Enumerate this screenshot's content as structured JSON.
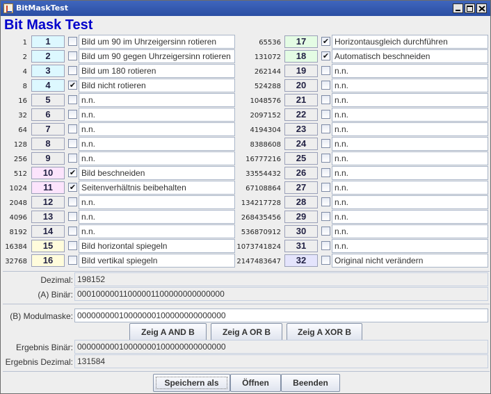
{
  "window": {
    "title": "BitMaskTest"
  },
  "heading": "Bit Mask Test",
  "left_rows": [
    {
      "value": "1",
      "bit": "1",
      "bit_color": "#ddf8ff",
      "checked": false,
      "label": "Bild um 90 im Uhrzeigersinn rotieren"
    },
    {
      "value": "2",
      "bit": "2",
      "bit_color": "#ddf8ff",
      "checked": false,
      "label": "Bild um 90 gegen Uhrzeigersinn rotieren"
    },
    {
      "value": "4",
      "bit": "3",
      "bit_color": "#ddf8ff",
      "checked": false,
      "label": "Bild um 180 rotieren"
    },
    {
      "value": "8",
      "bit": "4",
      "bit_color": "#ddf8ff",
      "checked": true,
      "label": "Bild nicht rotieren"
    },
    {
      "value": "16",
      "bit": "5",
      "bit_color": "#eeeeee",
      "checked": false,
      "label": "n.n."
    },
    {
      "value": "32",
      "bit": "6",
      "bit_color": "#eeeeee",
      "checked": false,
      "label": "n.n."
    },
    {
      "value": "64",
      "bit": "7",
      "bit_color": "#eeeeee",
      "checked": false,
      "label": "n.n."
    },
    {
      "value": "128",
      "bit": "8",
      "bit_color": "#eeeeee",
      "checked": false,
      "label": "n.n."
    },
    {
      "value": "256",
      "bit": "9",
      "bit_color": "#eeeeee",
      "checked": false,
      "label": "n.n."
    },
    {
      "value": "512",
      "bit": "10",
      "bit_color": "#fce4fc",
      "checked": true,
      "label": "Bild beschneiden"
    },
    {
      "value": "1024",
      "bit": "11",
      "bit_color": "#fce4fc",
      "checked": true,
      "label": "Seitenverhältnis beibehalten"
    },
    {
      "value": "2048",
      "bit": "12",
      "bit_color": "#eeeeee",
      "checked": false,
      "label": "n.n."
    },
    {
      "value": "4096",
      "bit": "13",
      "bit_color": "#eeeeee",
      "checked": false,
      "label": "n.n."
    },
    {
      "value": "8192",
      "bit": "14",
      "bit_color": "#eeeeee",
      "checked": false,
      "label": "n.n."
    },
    {
      "value": "16384",
      "bit": "15",
      "bit_color": "#fffcdc",
      "checked": false,
      "label": "Bild horizontal spiegeln"
    },
    {
      "value": "32768",
      "bit": "16",
      "bit_color": "#fffcdc",
      "checked": false,
      "label": "Bild vertikal spiegeln"
    }
  ],
  "right_rows": [
    {
      "value": "65536",
      "bit": "17",
      "bit_color": "#e4fce4",
      "checked": true,
      "label": "Horizontausgleich durchführen"
    },
    {
      "value": "131072",
      "bit": "18",
      "bit_color": "#e4fce4",
      "checked": true,
      "label": "Automatisch beschneiden"
    },
    {
      "value": "262144",
      "bit": "19",
      "bit_color": "#eeeeee",
      "checked": false,
      "label": "n.n."
    },
    {
      "value": "524288",
      "bit": "20",
      "bit_color": "#eeeeee",
      "checked": false,
      "label": "n.n."
    },
    {
      "value": "1048576",
      "bit": "21",
      "bit_color": "#eeeeee",
      "checked": false,
      "label": "n.n."
    },
    {
      "value": "2097152",
      "bit": "22",
      "bit_color": "#eeeeee",
      "checked": false,
      "label": "n.n."
    },
    {
      "value": "4194304",
      "bit": "23",
      "bit_color": "#eeeeee",
      "checked": false,
      "label": "n.n."
    },
    {
      "value": "8388608",
      "bit": "24",
      "bit_color": "#eeeeee",
      "checked": false,
      "label": "n.n."
    },
    {
      "value": "16777216",
      "bit": "25",
      "bit_color": "#eeeeee",
      "checked": false,
      "label": "n.n."
    },
    {
      "value": "33554432",
      "bit": "26",
      "bit_color": "#eeeeee",
      "checked": false,
      "label": "n.n."
    },
    {
      "value": "67108864",
      "bit": "27",
      "bit_color": "#eeeeee",
      "checked": false,
      "label": "n.n."
    },
    {
      "value": "134217728",
      "bit": "28",
      "bit_color": "#eeeeee",
      "checked": false,
      "label": "n.n."
    },
    {
      "value": "268435456",
      "bit": "29",
      "bit_color": "#eeeeee",
      "checked": false,
      "label": "n.n."
    },
    {
      "value": "536870912",
      "bit": "30",
      "bit_color": "#eeeeee",
      "checked": false,
      "label": "n.n."
    },
    {
      "value": "1073741824",
      "bit": "31",
      "bit_color": "#eeeeee",
      "checked": false,
      "label": "n.n."
    },
    {
      "value": "2147483647",
      "bit": "32",
      "bit_color": "#e4e4fc",
      "checked": false,
      "label": "Original nicht verändern"
    }
  ],
  "checkmark_glyph": "✔",
  "summary": {
    "decimal_label": "Dezimal:",
    "decimal_value": "198152",
    "binary_label": "(A) Binär:",
    "binary_value": "00010000011000001100000000000000"
  },
  "module": {
    "mask_label": "(B) Modulmaske:",
    "mask_value": "00000000010000000100000000000000",
    "and_button": "Zeig A AND B",
    "or_button": "Zeig A OR B",
    "xor_button": "Zeig A XOR B",
    "result_binary_label": "Ergebnis Binär:",
    "result_binary_value": "00000000010000000100000000000000",
    "result_decimal_label": "Ergebnis Dezimal:",
    "result_decimal_value": "131584"
  },
  "footer": {
    "save_button": "Speichern als",
    "open_button": "Öffnen",
    "exit_button": "Beenden"
  }
}
